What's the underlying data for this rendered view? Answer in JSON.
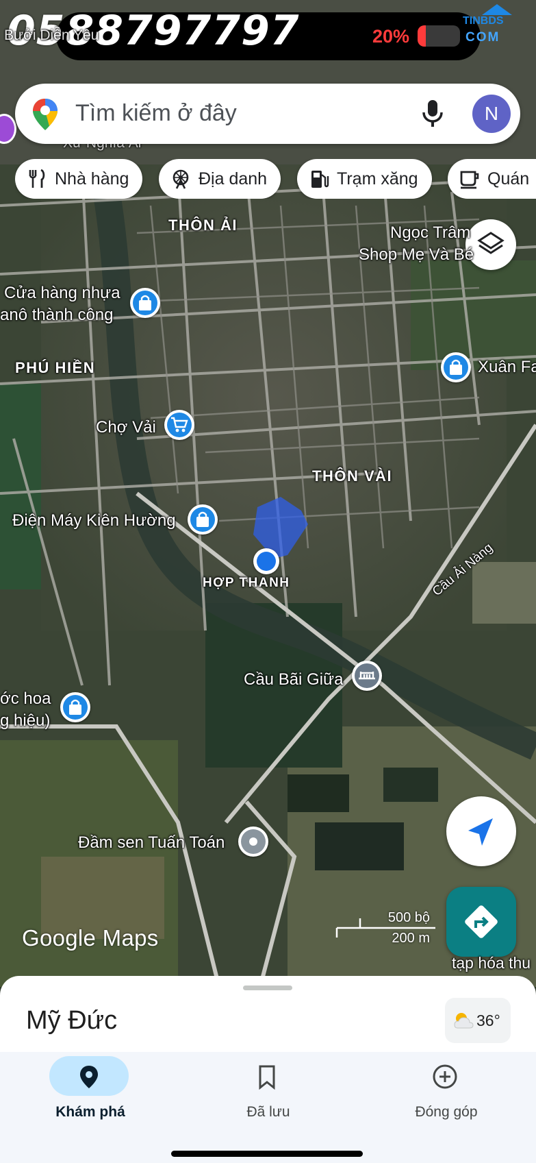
{
  "status_bar": {
    "watermark_phone": "0588797797",
    "battery_percent_label": "20%",
    "battery_level": 0.2,
    "brand_top": "TINBDS",
    "brand_bottom": "COM"
  },
  "search": {
    "placeholder": "Tìm kiếm ở đây",
    "avatar_initial": "N"
  },
  "chips": [
    {
      "label": "Nhà hàng",
      "icon": "fork-knife-icon"
    },
    {
      "label": "Địa danh",
      "icon": "ferris-wheel-icon"
    },
    {
      "label": "Trạm xăng",
      "icon": "gas-pump-icon"
    },
    {
      "label": "Quán",
      "icon": "coffee-cup-icon"
    }
  ],
  "map": {
    "top_partial_label": "Bưởi Diễn Yêu",
    "partial_label_2": "Xứ Nghĩa Ái",
    "areas": {
      "thon_ai": "THÔN ẢI",
      "phu_hien": "PHÚ HIỀN",
      "thon_vai": "THÔN VÀI",
      "hop_thanh": "HỢP THANH"
    },
    "places": {
      "ngoc_tram_1": "Ngọc Trâm",
      "ngoc_tram_2": "Shop Mẹ Và Bé",
      "cua_hang_1": "Cửa hàng nhựa",
      "cua_hang_2": "anô thành công",
      "xuan_fa": "Xuân Fa",
      "cho_vai": "Chợ Vải",
      "dien_may": "Điện Máy Kiên Hường",
      "cau_ai_nang": "Cầu Ải Nàng",
      "cau_bai_giua": "Cầu Bãi Giữa",
      "nuoc_hoa_1": "ớc hoa",
      "nuoc_hoa_2": "g hiệu)",
      "dam_sen": "Đầm sen Tuấn Toán",
      "tap_hoa": "tạp hóa thu"
    },
    "scale_imperial": "500 bộ",
    "scale_metric": "200 m",
    "logo": "Google Maps"
  },
  "sheet": {
    "title": "Mỹ Đức",
    "temperature": "36°",
    "weather_icon": "partly-cloudy-icon"
  },
  "bottom_nav": [
    {
      "label": "Khám phá",
      "icon": "explore-pin-icon",
      "active": true
    },
    {
      "label": "Đã lưu",
      "icon": "bookmark-icon",
      "active": false
    },
    {
      "label": "Đóng góp",
      "icon": "add-circle-icon",
      "active": false
    }
  ],
  "colors": {
    "accent_blue": "#1a73e8",
    "directions_teal": "#0b7f83",
    "battery_red": "#ff3b3b",
    "poi_blue": "#1e88e5",
    "avatar_purple": "#5f63c6"
  }
}
